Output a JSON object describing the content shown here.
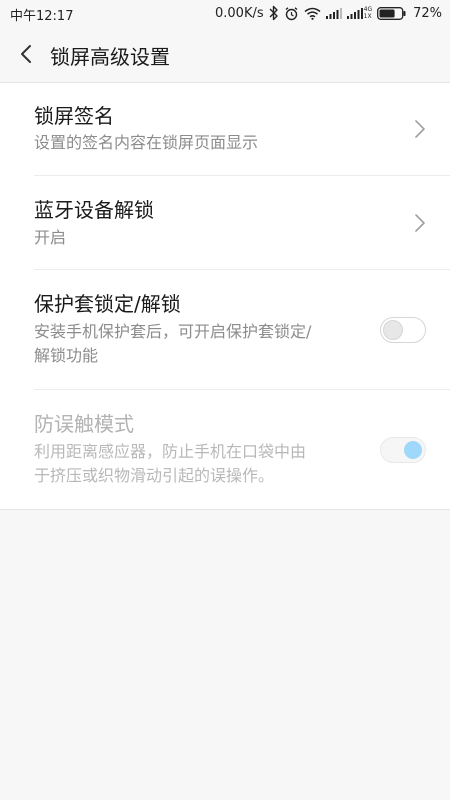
{
  "status_bar": {
    "time": "中午12:17",
    "net_speed": "0.00K/s",
    "network_label_top": "4G",
    "network_label_bottom": "1X",
    "battery_percent": "72%",
    "battery_level": 0.72
  },
  "header": {
    "title": "锁屏高级设置",
    "back_icon": "chevron-left-icon"
  },
  "settings": [
    {
      "title": "锁屏签名",
      "desc": "设置的签名内容在锁屏页面显示",
      "control": "chevron",
      "enabled": true
    },
    {
      "title": "蓝牙设备解锁",
      "desc": "开启",
      "control": "chevron",
      "enabled": true
    },
    {
      "title": "保护套锁定/解锁",
      "desc_line1": "安装手机保护套后，可开启保护套锁定/",
      "desc_line2": "解锁功能",
      "control": "toggle",
      "toggle_on": false,
      "enabled": true
    },
    {
      "title": "防误触模式",
      "desc_line1": "利用距离感应器，防止手机在口袋中由",
      "desc_line2": "于挤压或织物滑动引起的误操作。",
      "control": "toggle",
      "toggle_on": true,
      "enabled": false
    }
  ],
  "colors": {
    "background": "#f7f7f7",
    "card": "#ffffff",
    "title_text": "#1a1a1a",
    "desc_text": "#8c8c8c",
    "disabled_text": "#b3b3b3",
    "toggle_knob_on": "#9fd8fb"
  }
}
